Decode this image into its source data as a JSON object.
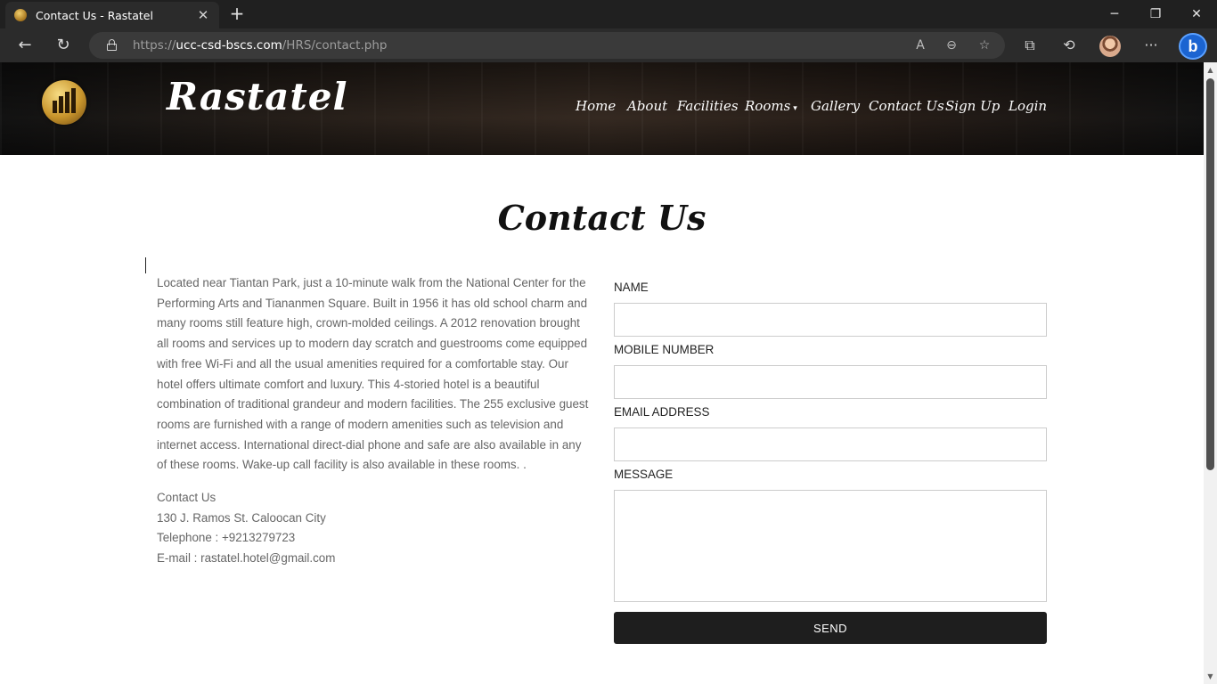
{
  "browser": {
    "tab_title": "Contact Us - Rastatel",
    "url_scheme": "https://",
    "url_host": "ucc-csd-bscs.com",
    "url_path": "/HRS/contact.php"
  },
  "site": {
    "brand": "Rastatel",
    "nav": [
      {
        "label": "Home"
      },
      {
        "label": "About"
      },
      {
        "label": "Facilities"
      },
      {
        "label": "Rooms"
      },
      {
        "label": "Gallery"
      },
      {
        "label": "Contact Us"
      },
      {
        "label": "Sign Up"
      },
      {
        "label": "Login"
      }
    ]
  },
  "main": {
    "title": "Contact Us",
    "description": "Located near Tiantan Park, just a 10-minute walk from the National Center for the Performing Arts and Tiananmen Square. Built in 1956 it has old school charm and many rooms still feature high, crown-molded ceilings. A 2012 renovation brought all rooms and services up to modern day scratch and guestrooms come equipped with free Wi-Fi and all the usual amenities required for a comfortable stay. Our hotel offers ultimate comfort and luxury. This 4-storied hotel is a beautiful combination of traditional grandeur and modern facilities. The 255 exclusive guest rooms are furnished with a range of modern amenities such as television and internet access. International direct-dial phone and safe are also available in any of these rooms. Wake-up call facility is also available in these rooms. .",
    "contact_heading": "Contact Us",
    "address": "130 J. Ramos St. Caloocan City",
    "telephone": "Telephone : +9213279723",
    "email": "E-mail : rastatel.hotel@gmail.com"
  },
  "form": {
    "name_label": "NAME",
    "mobile_label": "MOBILE NUMBER",
    "email_label": "EMAIL ADDRESS",
    "message_label": "MESSAGE",
    "send_label": "SEND"
  },
  "colors": {
    "button_bg": "#1e1e1e",
    "text_muted": "#666666"
  }
}
